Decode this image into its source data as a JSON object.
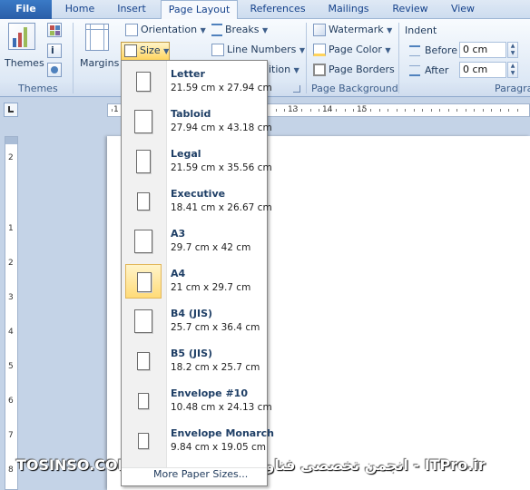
{
  "tabs": [
    "File",
    "Home",
    "Insert",
    "Page Layout",
    "References",
    "Mailings",
    "Review",
    "View"
  ],
  "ribbon": {
    "themes": {
      "button": "Themes",
      "group": "Themes"
    },
    "page_setup": {
      "margins": "Margins",
      "orientation": "Orientation",
      "size": "Size",
      "breaks": "Breaks",
      "line_numbers": "Line Numbers",
      "hyphenation_fragment": "ition"
    },
    "page_background": {
      "watermark": "Watermark",
      "page_color": "Page Color",
      "page_borders": "Page Borders",
      "group": "Page Background"
    },
    "paragraph": {
      "indent": "Indent",
      "before_label": "Before",
      "before_value": "0 cm",
      "after_label": "After",
      "after_value": "0 cm",
      "group": "Paragra"
    }
  },
  "ruler": {
    "h_numbers": [
      "1",
      "13",
      "14",
      "15"
    ],
    "v_numbers": [
      "2",
      "1",
      "2",
      "3",
      "4",
      "5",
      "6",
      "7",
      "8"
    ]
  },
  "size_menu": {
    "items": [
      {
        "name": "Letter",
        "dims": "21.59 cm x 27.94 cm",
        "w": 21.59,
        "h": 27.94
      },
      {
        "name": "Tabloid",
        "dims": "27.94 cm x 43.18 cm",
        "w": 27.94,
        "h": 43.18
      },
      {
        "name": "Legal",
        "dims": "21.59 cm x 35.56 cm",
        "w": 21.59,
        "h": 35.56
      },
      {
        "name": "Executive",
        "dims": "18.41 cm x 26.67 cm",
        "w": 18.41,
        "h": 26.67
      },
      {
        "name": "A3",
        "dims": "29.7 cm x 42 cm",
        "w": 29.7,
        "h": 42
      },
      {
        "name": "A4",
        "dims": "21 cm x 29.7 cm",
        "w": 21,
        "h": 29.7,
        "selected": true
      },
      {
        "name": "B4 (JIS)",
        "dims": "25.7 cm x 36.4 cm",
        "w": 25.7,
        "h": 36.4
      },
      {
        "name": "B5 (JIS)",
        "dims": "18.2 cm x 25.7 cm",
        "w": 18.2,
        "h": 25.7
      },
      {
        "name": "Envelope #10",
        "dims": "10.48 cm x 24.13 cm",
        "w": 10.48,
        "h": 24.13
      },
      {
        "name": "Envelope Monarch",
        "dims": "9.84 cm x 19.05 cm",
        "w": 9.84,
        "h": 19.05
      }
    ],
    "more": "More Paper Sizes..."
  },
  "watermark_text": "TOSINSO.COM انجمن تخصصی فناوری اطلاعات ایران - ITPro.ir",
  "colors": {
    "accent": "#2a5ea8",
    "selection": "#ffdb78"
  }
}
